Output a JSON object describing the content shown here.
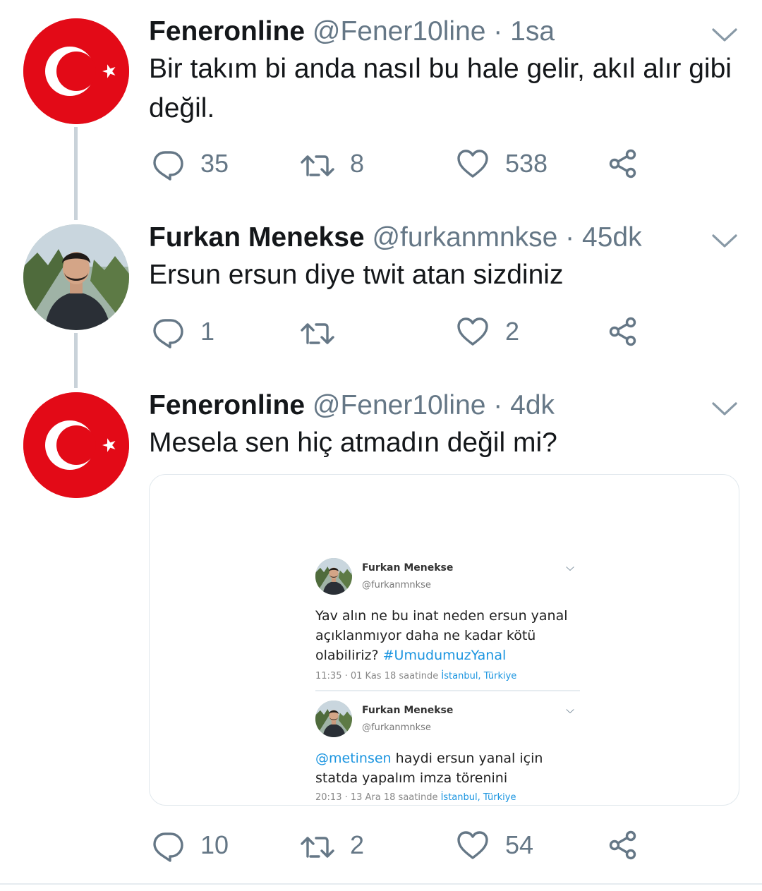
{
  "tweets": [
    {
      "name": "Feneronline",
      "handle": "@Fener10line",
      "separator": "·",
      "time": "1sa",
      "text": "Bir takım bi anda nasıl bu hale gelir, akıl alır gibi değil.",
      "replies": "35",
      "retweets": "8",
      "likes": "538",
      "avatar": "turkish-flag"
    },
    {
      "name": "Furkan Menekse",
      "handle": "@furkanmnkse",
      "separator": "·",
      "time": "45dk",
      "text": "Ersun ersun diye twit atan sizdiniz",
      "replies": "1",
      "retweets": "",
      "likes": "2",
      "avatar": "user-photo"
    },
    {
      "name": "Feneronline",
      "handle": "@Fener10line",
      "separator": "·",
      "time": "4dk",
      "text": "Mesela sen hiç atmadın değil mi?",
      "replies": "10",
      "retweets": "2",
      "likes": "54",
      "avatar": "turkish-flag"
    }
  ],
  "embedded_screenshot": {
    "tweets": [
      {
        "name": "Furkan Menekse",
        "handle": "@furkanmnkse",
        "text_lines": [
          "Yav alın ne bu inat neden ersun yanal",
          "açıklanmıyor daha ne kadar kötü",
          "olabiliriz?"
        ],
        "hashtag": "#UmudumuzYanal",
        "meta_time": "11:35 · 01 Kas 18 saatinde",
        "meta_location": "İstanbul, Türkiye"
      },
      {
        "name": "Furkan Menekse",
        "handle": "@furkanmnkse",
        "mention": "@metinsen",
        "text_rest": " haydi ersun yanal için",
        "text_line2": "statda yapalım imza törenini",
        "meta_time": "20:13 · 13 Ara 18 saatinde",
        "meta_location": "İstanbul, Türkiye"
      }
    ]
  },
  "icons": {
    "reply": "reply-icon",
    "retweet": "retweet-icon",
    "like": "heart-icon",
    "share": "share-icon",
    "menu": "chevron-down-icon"
  },
  "colors": {
    "text": "#14171a",
    "secondary": "#657786",
    "flag_red": "#e30a17",
    "link": "#1b95e0",
    "thread_line": "#c9d2d9"
  }
}
